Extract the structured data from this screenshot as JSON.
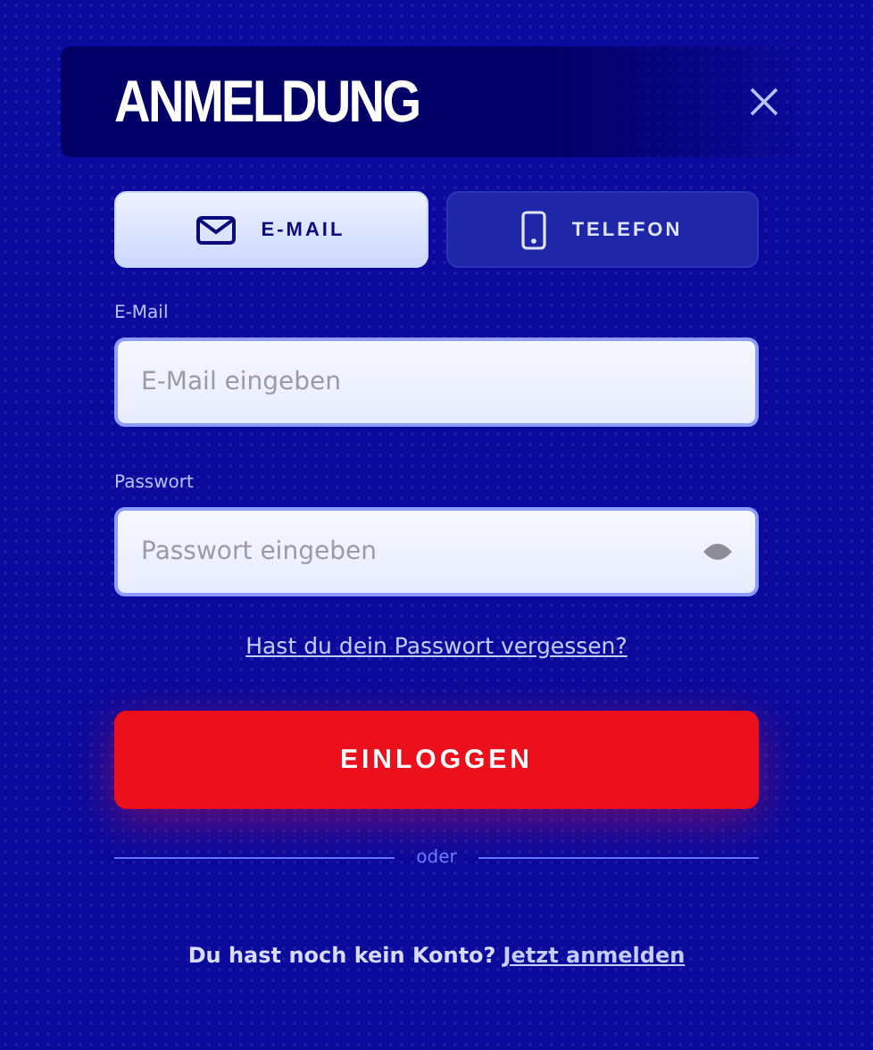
{
  "dialog": {
    "title": "ANMELDUNG"
  },
  "tabs": [
    {
      "label": "E-MAIL",
      "selected": true
    },
    {
      "label": "TELEFON",
      "selected": false
    }
  ],
  "fields": [
    {
      "label": "E-Mail",
      "placeholder": "E-Mail eingeben",
      "kind": "text"
    },
    {
      "label": "Passwort",
      "placeholder": "Passwort eingeben",
      "kind": "password"
    }
  ],
  "forgot_link": "Hast du dein Passwort vergessen?",
  "login_button": "EINLOGGEN",
  "divider": "oder",
  "footer": {
    "prompt": "Du hast noch kein Konto?",
    "link": "Jetzt anmelden"
  }
}
